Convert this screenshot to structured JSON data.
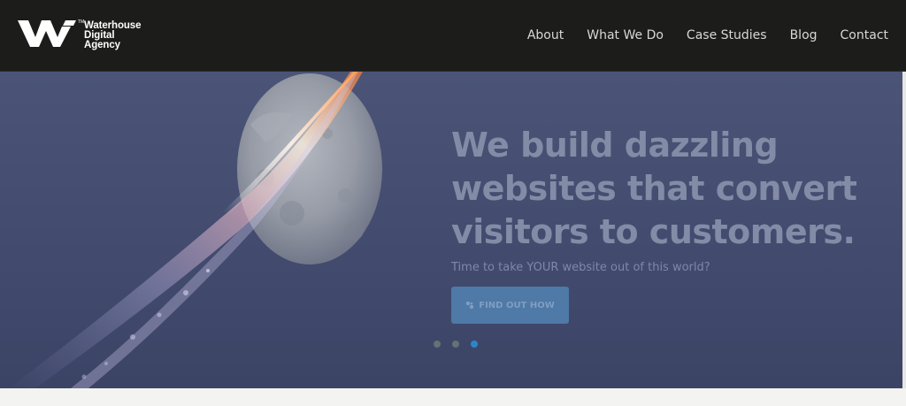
{
  "brand": {
    "name_line1": "Waterhouse",
    "name_line2": "Digital",
    "name_line3": "Agency",
    "tm": "TM",
    "logo_icon": "waterhouse-w-icon"
  },
  "nav": {
    "items": [
      {
        "label": "About"
      },
      {
        "label": "What We Do"
      },
      {
        "label": "Case Studies"
      },
      {
        "label": "Blog"
      },
      {
        "label": "Contact"
      }
    ]
  },
  "hero": {
    "headline_line1": "We build dazzling",
    "headline_line2": "websites that convert",
    "headline_line3": "visitors to customers.",
    "subheadline": "Time to take YOUR website out of this world?",
    "cta_label": "FIND OUT HOW",
    "cta_icon": "rocket-icon",
    "slides": [
      {
        "active": false
      },
      {
        "active": false
      },
      {
        "active": true
      }
    ]
  },
  "colors": {
    "header_bg": "#1c1c1b",
    "hero_bg": "#464f72",
    "cta_bg": "#4f79a6",
    "dot_active": "#2a86c9",
    "dot_inactive": "#677073"
  }
}
